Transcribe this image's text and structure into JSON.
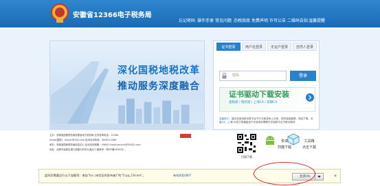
{
  "header": {
    "title": "安徽省12366电子税务局",
    "nav": [
      "忘记密码",
      "操作手册",
      "常见问题",
      "办税指南",
      "免费声明",
      "许可公告",
      "二维码告知",
      "温馨提醒"
    ]
  },
  "banner": {
    "slogan1": "深化国税地税改革",
    "slogan2": "推动服务深度融合"
  },
  "login": {
    "tabs": [
      "证书登录",
      "用户名登录",
      "无证户登录",
      "自然人登录"
    ],
    "password_placeholder": "密码",
    "login_button": "登录",
    "download_title": "证书驱动下载安装",
    "download_sub": "金税盘 / 税控盘 / 上海CA / 安徽CA",
    "tips_label": "温馨提示：",
    "tips_text": "建议您使用税务数字证书方式登录网上办税，您好接盘管理，网站下载，安装CA，上海CA或刀笔通盘用户在使用前需要先安装数字证书驱动程序"
  },
  "footer": {
    "lines": [
      "主办：安徽省国家税务局安徽省地方税务局  业务咨询电话：12366",
      "Email(国税)：tesver@163.com  技术支持热线：4008112366",
      "承办：安徽省国家税务局信息中心  技术支持邮箱：99843  Email:service@95432.com",
      "地址：合肥市高新区望江西路与科学大道交口  备案号：皖ICP备090038..."
    ],
    "qr_label": "扫描下载",
    "app_title": "安卓版",
    "app_sub": "扫描下载",
    "tool_title": "工具箱",
    "tool_sub": "点击下载"
  },
  "notification": {
    "text": "此网页需要运行以下加载项：来自“Inc (未验证的发布者)”的“Cryp_CXcore”。",
    "link": "有何风险(W)?",
    "allow_button": "允许(A)",
    "close": "×"
  },
  "colors": {
    "header_blue": "#2f86cf",
    "accent_blue": "#2b80cc",
    "green": "#2f9c5a",
    "notify_bg": "#fdfdea",
    "highlight_red": "#e02020"
  }
}
